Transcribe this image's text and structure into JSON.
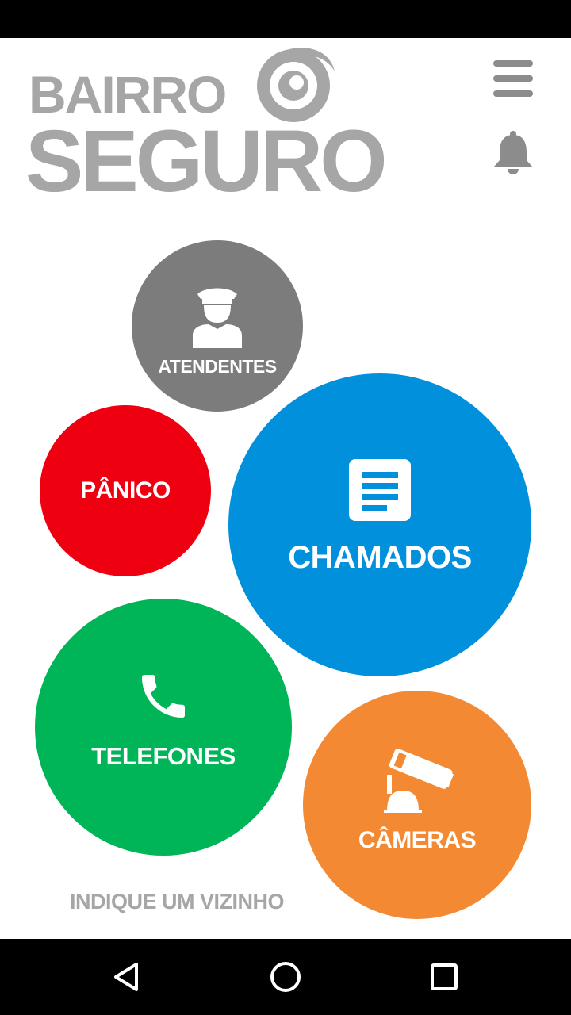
{
  "logo": {
    "line1": "BAIRRO",
    "line2": "SEGURO"
  },
  "header": {
    "menu_icon": "hamburger-menu-icon",
    "notification_icon": "bell-icon"
  },
  "bubbles": {
    "atendentes": {
      "label": "ATENDENTES",
      "icon": "guard-icon",
      "color": "#7c7c7c"
    },
    "panico": {
      "label": "PÂNICO",
      "color": "#ee0011"
    },
    "chamados": {
      "label": "CHAMADOS",
      "icon": "document-list-icon",
      "color": "#0090dc"
    },
    "telefones": {
      "label": "TELEFONES",
      "icon": "phone-icon",
      "color": "#00b558"
    },
    "cameras": {
      "label": "CÂMERAS",
      "icon": "security-camera-icon",
      "color": "#f38a33"
    }
  },
  "footer": {
    "indique": "INDIQUE UM VIZINHO"
  },
  "navigation": {
    "back_icon": "back-icon",
    "home_icon": "home-icon",
    "recents_icon": "recents-icon"
  }
}
